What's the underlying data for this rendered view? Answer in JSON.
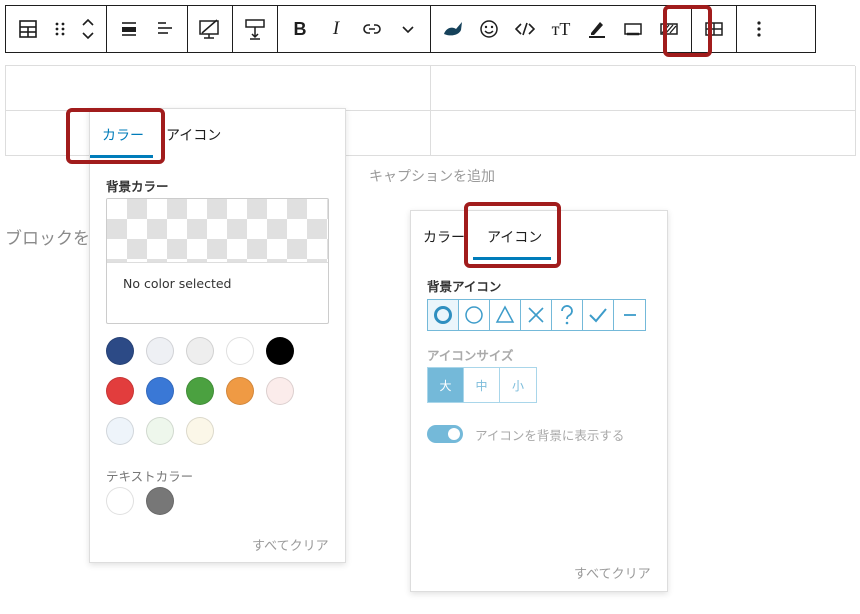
{
  "toolbar": {
    "groups": [
      [
        "table-icon",
        "drag-handle-icon",
        "move-up-down-icon"
      ],
      [
        "align-icon",
        "justify-icon"
      ],
      [
        "desktop-icon"
      ],
      [
        "insert-row-icon"
      ],
      [
        "bold-icon",
        "italic-icon",
        "link-icon",
        "chevron-down-icon"
      ],
      [
        "highlighter-icon",
        "emoji-icon",
        "code-icon",
        "font-size-icon",
        "text-color-icon",
        "frame-icon",
        "cell-background-icon"
      ],
      [
        "table-layout-icon"
      ],
      [
        "more-options-icon"
      ]
    ],
    "bold_label": "B",
    "italic_label": "I",
    "font_size_label": "тT"
  },
  "caption_placeholder": "キャプションを追加",
  "block_hint": "ブロックを",
  "color_panel": {
    "tab_color": "カラー",
    "tab_icon": "アイコン",
    "bg_color_label": "背景カラー",
    "no_color_text": "No color selected",
    "bg_swatches": [
      "#2c4a86",
      "#eef0f4",
      "#eeeeee",
      "#ffffff",
      "#000000",
      "#e23d3d",
      "#3a78d6",
      "#4ba140",
      "#ef9a44",
      "#fbeceb",
      "#eef4fa",
      "#eef7ec",
      "#fbf7e8"
    ],
    "text_color_label": "テキストカラー",
    "text_swatches": [
      "#ffffff",
      "#777777"
    ],
    "clear_all": "すべてクリア"
  },
  "icon_panel": {
    "tab_color": "カラー",
    "tab_icon": "アイコン",
    "bg_icon_label": "背景アイコン",
    "icons": [
      "circle-bold-icon",
      "circle-icon",
      "triangle-icon",
      "cross-icon",
      "question-icon",
      "check-icon",
      "minus-icon"
    ],
    "icon_size_label": "アイコンサイズ",
    "sizes": [
      "大",
      "中",
      "小"
    ],
    "toggle_label": "アイコンを背景に表示する",
    "clear_all": "すべてクリア"
  },
  "colors": {
    "accent": "#007cba",
    "highlight": "#a11c1c",
    "icon_accent": "#74b9d9"
  }
}
